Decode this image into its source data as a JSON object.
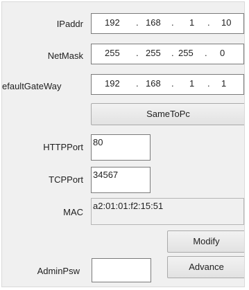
{
  "ip_addr": {
    "label": "IPaddr",
    "octets": [
      "192",
      "168",
      "1",
      "10"
    ]
  },
  "net_mask": {
    "label": "NetMask",
    "octets": [
      "255",
      "255",
      "255",
      "0"
    ]
  },
  "default_gateway": {
    "label": "efaultGateWay",
    "octets": [
      "192",
      "168",
      "1",
      "1"
    ]
  },
  "separator": ".",
  "same_to_pc_label": "SameToPc",
  "http_port": {
    "label": "HTTPPort",
    "value": "80"
  },
  "tcp_port": {
    "label": "TCPPort",
    "value": "34567"
  },
  "mac": {
    "label": "MAC",
    "value": "a2:01:01:f2:15:51"
  },
  "modify_label": "Modify",
  "admin_psw": {
    "label": "AdminPsw",
    "value": ""
  },
  "advance_label": "Advance"
}
